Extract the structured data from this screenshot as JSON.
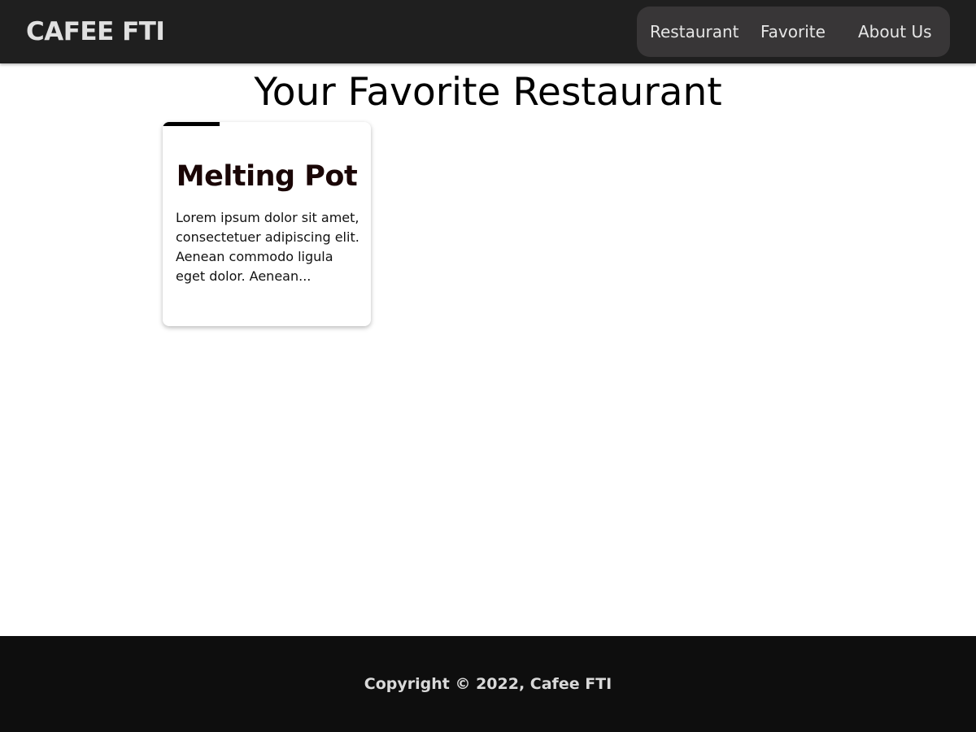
{
  "header": {
    "brand": "CAFEE FTI",
    "nav": {
      "restaurant": "Restaurant",
      "favorite": "Favorite",
      "about": "About Us"
    }
  },
  "main": {
    "heading": "Your Favorite Restaurant",
    "restaurants": [
      {
        "name": "Melting Pot",
        "description": "Lorem ipsum dolor sit amet, consectetuer adipiscing elit. Aenean commodo ligula eget dolor. Aenean..."
      }
    ]
  },
  "footer": {
    "copyright": "Copyright © 2022, Cafee FTI"
  },
  "colors": {
    "header_bg": "#1f1f1f",
    "nav_bg": "#383637",
    "footer_bg": "#0e0e0e",
    "card_accent": "#000000"
  }
}
